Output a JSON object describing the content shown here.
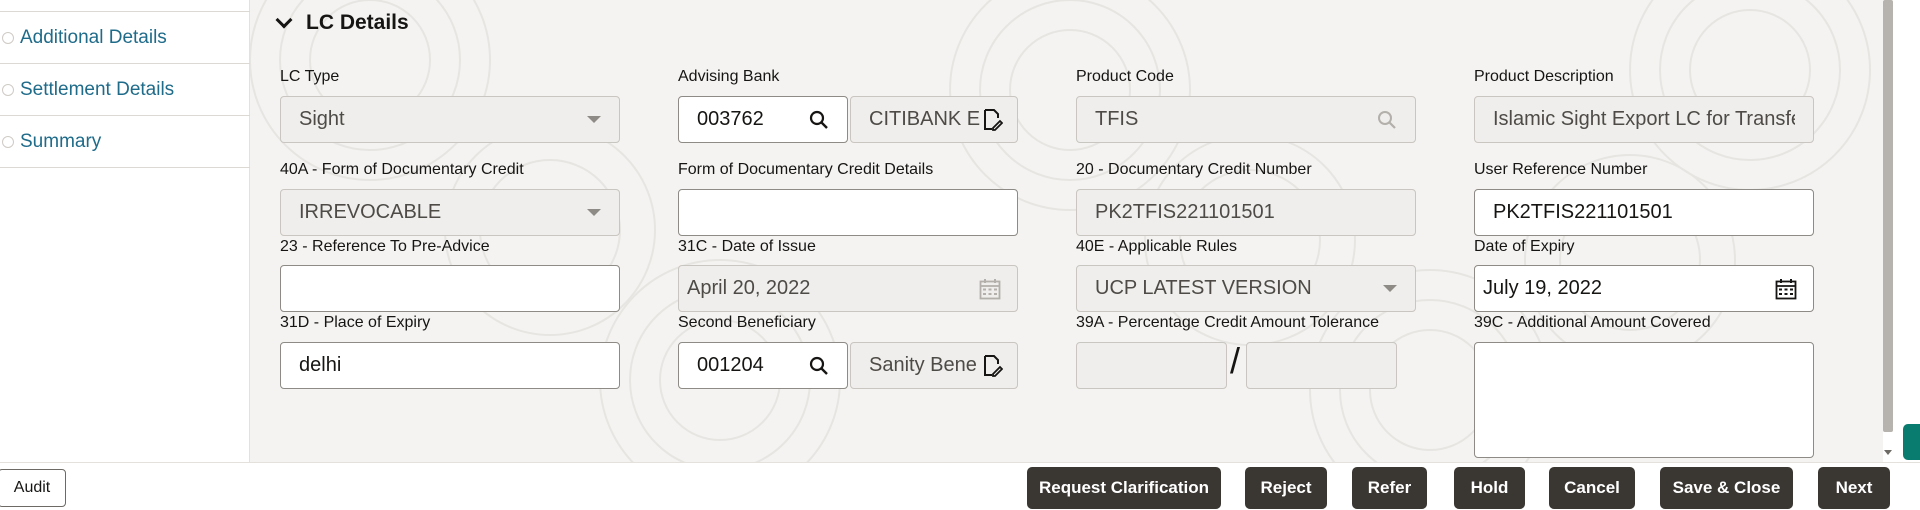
{
  "sidebar": {
    "items": [
      {
        "label": "Additional Details"
      },
      {
        "label": "Settlement Details"
      },
      {
        "label": "Summary"
      }
    ]
  },
  "section": {
    "title": "LC Details"
  },
  "fields": {
    "lc_type": {
      "label": "LC Type",
      "value": "Sight"
    },
    "advising_bank": {
      "label": "Advising Bank",
      "code": "003762",
      "name": "CITIBANK E"
    },
    "product_code": {
      "label": "Product Code",
      "value": "TFIS"
    },
    "product_description": {
      "label": "Product Description",
      "value": "Islamic Sight Export LC for Transfer"
    },
    "form_doc_credit": {
      "label": "40A - Form of Documentary Credit",
      "value": "IRREVOCABLE"
    },
    "form_doc_credit_details": {
      "label": "Form of Documentary Credit Details",
      "value": ""
    },
    "doc_credit_number": {
      "label": "20 - Documentary Credit Number",
      "value": "PK2TFIS221101501"
    },
    "user_reference_number": {
      "label": "User Reference Number",
      "value": "PK2TFIS221101501"
    },
    "ref_pre_advice": {
      "label": "23 - Reference To Pre-Advice",
      "value": ""
    },
    "date_of_issue": {
      "label": "31C - Date of Issue",
      "value": "April 20, 2022"
    },
    "applicable_rules": {
      "label": "40E - Applicable Rules",
      "value": "UCP LATEST VERSION"
    },
    "date_of_expiry": {
      "label": "Date of Expiry",
      "value": "July 19, 2022"
    },
    "place_of_expiry": {
      "label": "31D - Place of Expiry",
      "value": "delhi"
    },
    "second_beneficiary": {
      "label": "Second Beneficiary",
      "code": "001204",
      "name": "Sanity Bene"
    },
    "pct_credit_tolerance": {
      "label": "39A - Percentage Credit Amount Tolerance",
      "separator": "/"
    },
    "additional_amount": {
      "label": "39C - Additional Amount Covered",
      "value": ""
    }
  },
  "footer": {
    "audit": "Audit",
    "buttons": {
      "request_clarification": "Request Clarification",
      "reject": "Reject",
      "refer": "Refer",
      "hold": "Hold",
      "cancel": "Cancel",
      "save_close": "Save & Close",
      "next": "Next"
    }
  },
  "colors": {
    "link": "#1f6b8a",
    "button_dark": "#3a3632",
    "accent_tab": "#0a7c6f",
    "panel_bg": "#f4f3f1"
  }
}
